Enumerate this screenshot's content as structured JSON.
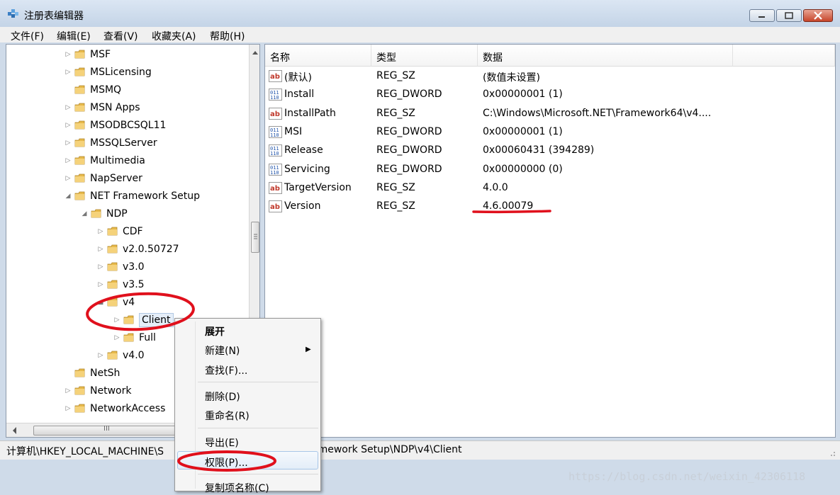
{
  "window": {
    "title": "注册表编辑器",
    "menu": [
      "文件(F)",
      "编辑(E)",
      "查看(V)",
      "收藏夹(A)",
      "帮助(H)"
    ]
  },
  "tree": {
    "items": [
      {
        "label": "MSF",
        "level": 0,
        "arrow": "▷"
      },
      {
        "label": "MSLicensing",
        "level": 0,
        "arrow": "▷"
      },
      {
        "label": "MSMQ",
        "level": 0,
        "arrow": ""
      },
      {
        "label": "MSN Apps",
        "level": 0,
        "arrow": "▷"
      },
      {
        "label": "MSODBCSQL11",
        "level": 0,
        "arrow": "▷"
      },
      {
        "label": "MSSQLServer",
        "level": 0,
        "arrow": "▷"
      },
      {
        "label": "Multimedia",
        "level": 0,
        "arrow": "▷"
      },
      {
        "label": "NapServer",
        "level": 0,
        "arrow": "▷"
      },
      {
        "label": "NET Framework Setup",
        "level": 0,
        "arrow": "◢"
      },
      {
        "label": "NDP",
        "level": 1,
        "arrow": "◢"
      },
      {
        "label": "CDF",
        "level": 2,
        "arrow": "▷"
      },
      {
        "label": "v2.0.50727",
        "level": 2,
        "arrow": "▷"
      },
      {
        "label": "v3.0",
        "level": 2,
        "arrow": "▷"
      },
      {
        "label": "v3.5",
        "level": 2,
        "arrow": "▷"
      },
      {
        "label": "v4",
        "level": 2,
        "arrow": "◢"
      },
      {
        "label": "Client",
        "level": 3,
        "arrow": "▷",
        "selected": true
      },
      {
        "label": "Full",
        "level": 3,
        "arrow": "▷"
      },
      {
        "label": "v4.0",
        "level": 2,
        "arrow": "▷"
      },
      {
        "label": "NetSh",
        "level": 0,
        "arrow": ""
      },
      {
        "label": "Network",
        "level": 0,
        "arrow": "▷"
      },
      {
        "label": "NetworkAccess",
        "level": 0,
        "arrow": "▷"
      }
    ],
    "hscroll_label": "III"
  },
  "values": {
    "headers": {
      "name": "名称",
      "type": "类型",
      "data": "数据"
    },
    "rows": [
      {
        "icon": "string-value-icon",
        "name": "(默认)",
        "type": "REG_SZ",
        "data": "(数值未设置)"
      },
      {
        "icon": "binary-value-icon",
        "name": "Install",
        "type": "REG_DWORD",
        "data": "0x00000001 (1)"
      },
      {
        "icon": "string-value-icon",
        "name": "InstallPath",
        "type": "REG_SZ",
        "data": "C:\\Windows\\Microsoft.NET\\Framework64\\v4...."
      },
      {
        "icon": "binary-value-icon",
        "name": "MSI",
        "type": "REG_DWORD",
        "data": "0x00000001 (1)"
      },
      {
        "icon": "binary-value-icon",
        "name": "Release",
        "type": "REG_DWORD",
        "data": "0x00060431 (394289)"
      },
      {
        "icon": "binary-value-icon",
        "name": "Servicing",
        "type": "REG_DWORD",
        "data": "0x00000000 (0)"
      },
      {
        "icon": "string-value-icon",
        "name": "TargetVersion",
        "type": "REG_SZ",
        "data": "4.0.0"
      },
      {
        "icon": "string-value-icon",
        "name": "Version",
        "type": "REG_SZ",
        "data": "4.6.00079"
      }
    ]
  },
  "status": {
    "path_left": "计算机\\HKEY_LOCAL_MACHINE\\S",
    "path_right": "amework Setup\\NDP\\v4\\Client"
  },
  "context_menu": {
    "expand": "展开",
    "new": "新建(N)",
    "find": "查找(F)...",
    "delete": "删除(D)",
    "rename": "重命名(R)",
    "export": "导出(E)",
    "permissions": "权限(P)...",
    "copy_key_name": "复制项名称(C)"
  },
  "watermark": "https://blog.csdn.net/weixin_42306118",
  "colors": {
    "annotation_red": "#e0101c",
    "selection": "#e5eef8"
  }
}
